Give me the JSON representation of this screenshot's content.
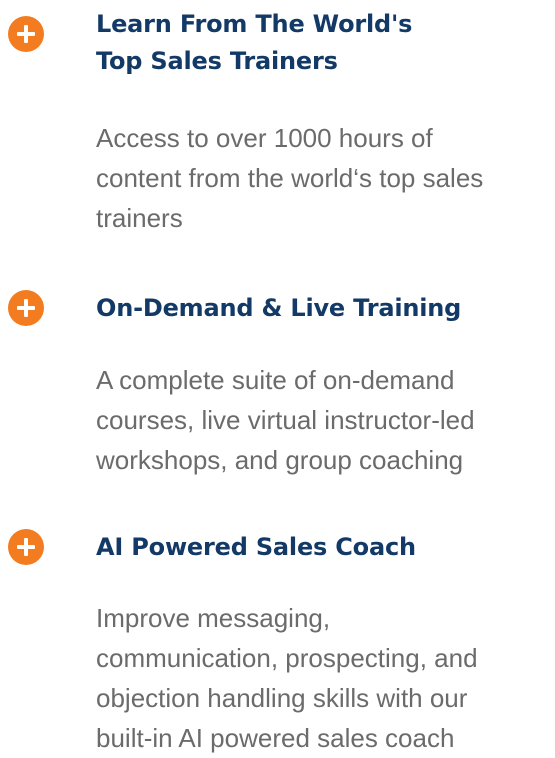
{
  "features": [
    {
      "icon": "plus-icon",
      "title": "Learn From The World's\nTop Sales Trainers",
      "description": "Access to over 1000 hours of\ncontent from the world‘s top sales\ntrainers"
    },
    {
      "icon": "plus-icon",
      "title": "On-Demand & Live Training",
      "description": "A complete suite of on-demand\ncourses, live virtual instructor-led\nworkshops, and group coaching"
    },
    {
      "icon": "plus-icon",
      "title": "AI Powered Sales Coach",
      "description": "Improve messaging,\ncommunication, prospecting, and\nobjection handling skills with our\nbuilt-in AI powered sales coach"
    }
  ],
  "colors": {
    "accent": "#f47c20",
    "title": "#133a66",
    "body_text": "#6b6b6b",
    "background": "#ffffff"
  }
}
